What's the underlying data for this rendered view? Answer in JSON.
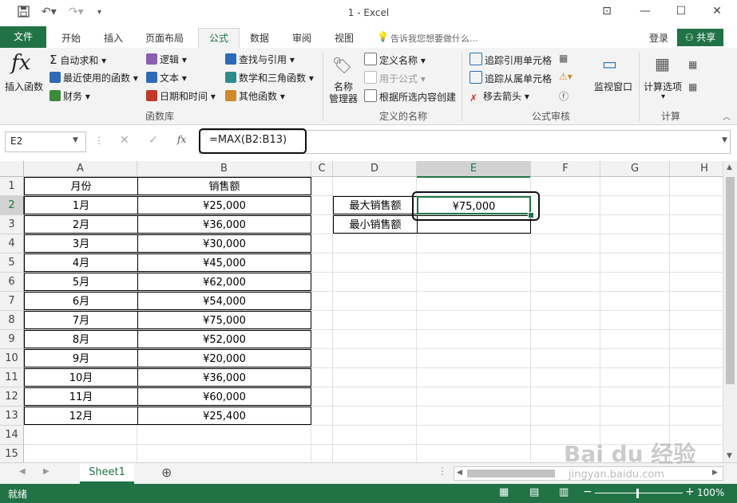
{
  "title_bar": {
    "title": "1 - Excel",
    "save_icon": "save-icon",
    "undo_icon": "undo-icon",
    "redo_icon": "redo-icon",
    "window_buttons": [
      "ribbon-display-icon",
      "minimize-icon",
      "maximize-icon",
      "close-icon"
    ]
  },
  "tabs": {
    "file": "文件",
    "items": [
      "开始",
      "插入",
      "页面布局",
      "公式",
      "数据",
      "审阅",
      "视图"
    ],
    "active": "公式",
    "tell_me": "告诉我您想要做什么...",
    "login": "登录",
    "share": "共享"
  },
  "ribbon": {
    "insert_function": "插入函数",
    "autosum": "自动求和",
    "recent": "最近使用的函数",
    "financial": "财务",
    "logical": "逻辑",
    "text": "文本",
    "datetime": "日期和时间",
    "lookup": "查找与引用",
    "math": "数学和三角函数",
    "other": "其他函数",
    "group_library": "函数库",
    "name_manager_1": "名称",
    "name_manager_2": "管理器",
    "define_name": "定义名称",
    "use_in_formula": "用于公式",
    "create_from_selection": "根据所选内容创建",
    "group_names": "定义的名称",
    "trace_precedents": "追踪引用单元格",
    "trace_dependents": "追踪从属单元格",
    "remove_arrows": "移去箭头",
    "group_audit": "公式审核",
    "watch_window": "监视窗口",
    "calc_options": "计算选项",
    "group_calc": "计算"
  },
  "formula_bar": {
    "name_box": "E2",
    "fx": "fx",
    "formula": "=MAX(B2:B13)"
  },
  "sheet": {
    "columns": [
      "A",
      "B",
      "C",
      "D",
      "E",
      "F",
      "G",
      "H"
    ],
    "rows": [
      "1",
      "2",
      "3",
      "4",
      "5",
      "6",
      "7",
      "8",
      "9",
      "10",
      "11",
      "12",
      "13",
      "14",
      "15"
    ],
    "header_a": "月份",
    "header_b": "销售额",
    "months": [
      "1月",
      "2月",
      "3月",
      "4月",
      "5月",
      "6月",
      "7月",
      "8月",
      "9月",
      "10月",
      "11月",
      "12月"
    ],
    "sales": [
      "¥25,000",
      "¥36,000",
      "¥30,000",
      "¥45,000",
      "¥62,000",
      "¥54,000",
      "¥75,000",
      "¥52,000",
      "¥20,000",
      "¥36,000",
      "¥60,000",
      "¥25,400"
    ],
    "label_max": "最大销售额",
    "label_min": "最小销售额",
    "max_value": "¥75,000",
    "min_value": ""
  },
  "sheet_tabs": {
    "active": "Sheet1",
    "add": "⊕"
  },
  "status_bar": {
    "status": "就绪",
    "zoom": "100%"
  },
  "watermark": {
    "text": "Bai du 经验",
    "url": "jingyan.baidu.com"
  }
}
